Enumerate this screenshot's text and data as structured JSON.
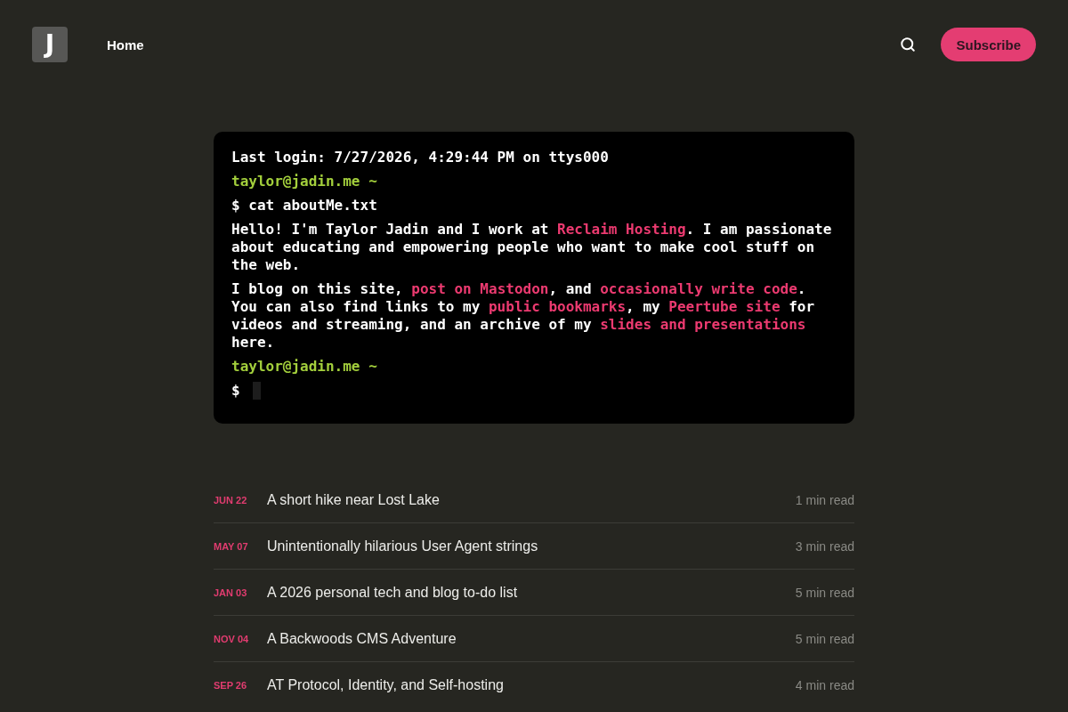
{
  "header": {
    "logo": "J",
    "nav": [
      {
        "label": "Home"
      }
    ],
    "subscribe_button": "Subscribe"
  },
  "terminal": {
    "lines": [
      {
        "kind": "output",
        "text": "Last login: 7/27/2026, 4:29:44 PM on ttys000"
      },
      {
        "kind": "prompt",
        "text": "taylor@jadin.me ~"
      },
      {
        "kind": "command",
        "text": "$ cat aboutMe.txt"
      },
      {
        "kind": "paragraph",
        "segments": [
          {
            "kind": "text",
            "text": "Hello! I'm Taylor Jadin and I work at "
          },
          {
            "kind": "link",
            "text": "Reclaim Hosting"
          },
          {
            "kind": "text",
            "text": ". I am passionate about educating and empowering people who want to make cool stuff on the web."
          }
        ]
      },
      {
        "kind": "paragraph",
        "segments": [
          {
            "kind": "text",
            "text": "I blog on this site, "
          },
          {
            "kind": "link",
            "text": "post on Mastodon"
          },
          {
            "kind": "text",
            "text": ", and "
          },
          {
            "kind": "link",
            "text": "occasionally write code"
          },
          {
            "kind": "text",
            "text": ". You can also find links to my "
          },
          {
            "kind": "link",
            "text": "public bookmarks"
          },
          {
            "kind": "text",
            "text": ", my "
          },
          {
            "kind": "link",
            "text": "Peertube site"
          },
          {
            "kind": "text",
            "text": " for videos and streaming, and an archive of my "
          },
          {
            "kind": "link",
            "text": "slides and presentations"
          },
          {
            "kind": "text",
            "text": " here."
          }
        ]
      },
      {
        "kind": "prompt",
        "text": "taylor@jadin.me ~"
      },
      {
        "kind": "input",
        "text": "$"
      }
    ]
  },
  "posts": [
    {
      "date": "JUN 22",
      "title": "A short hike near Lost Lake",
      "read_time": "1 min read"
    },
    {
      "date": "MAY 07",
      "title": "Unintentionally hilarious User Agent strings",
      "read_time": "3 min read"
    },
    {
      "date": "JAN 03",
      "title": "A 2026 personal tech and blog to-do list",
      "read_time": "5 min read"
    },
    {
      "date": "NOV 04",
      "title": "A Backwoods CMS Adventure",
      "read_time": "5 min read"
    },
    {
      "date": "SEP 26",
      "title": "AT Protocol, Identity, and Self-hosting",
      "read_time": "4 min read"
    }
  ]
}
